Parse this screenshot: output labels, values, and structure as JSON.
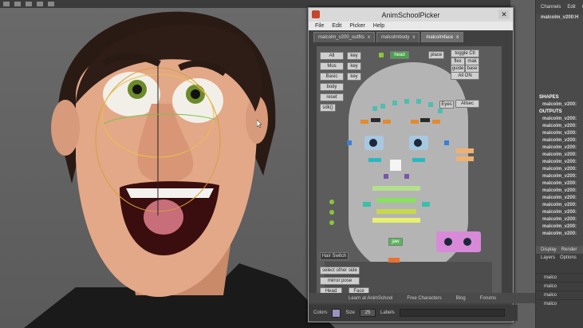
{
  "picker": {
    "title": "AnimSchoolPicker",
    "close": "✕",
    "menu": [
      "File",
      "Edit",
      "Picker",
      "Help"
    ],
    "tabs": [
      {
        "label": "malcolm_v200_outfits",
        "close": "x"
      },
      {
        "label": "malcolmbody",
        "close": "x"
      },
      {
        "label": "malcolmface",
        "close": "x"
      }
    ],
    "buttons": {
      "all": "All",
      "key1": "key",
      "mus": "Mus",
      "key2": "key",
      "basic": "Basic",
      "key3": "key",
      "body": "body",
      "reset": "reset",
      "sdk": "sdk()",
      "head": "head",
      "place": "place",
      "toggle": "toggle Ctl",
      "flex": "flex",
      "mak": "mak",
      "guide": "guide",
      "base": "base",
      "all_on": "All ON",
      "eyes": "Eyes",
      "allsec": "Allsec",
      "jaw": "jaw",
      "hair_switch": "Hair Switch",
      "select_other_side": "select other side",
      "mirror_pose": "mirror pose",
      "head2": "Head",
      "face": "Face"
    },
    "footer": [
      "Learn at AnimSchool",
      "Free Characters",
      "Blog",
      "Forums"
    ],
    "bottom": {
      "colors_label": "Colors",
      "size_label": "Size",
      "size_value": "25",
      "labels_label": "Labels",
      "swatch_color": "#9a93c0"
    }
  },
  "right_panel": {
    "tabs": [
      "Channels",
      "Edit",
      "O"
    ],
    "node": "malcolm_v200:H",
    "shapes_label": "SHAPES",
    "shapes": [
      "malcolm_v200:"
    ],
    "outputs_label": "OUTPUTS",
    "outputs": [
      "malcolm_v200:",
      "malcolm_v200:",
      "malcolm_v200:",
      "malcolm_v200:",
      "malcolm_v200:",
      "malcolm_v200:",
      "malcolm_v200:",
      "malcolm_v200:",
      "malcolm_v200:",
      "malcolm_v200:",
      "malcolm_v200:",
      "malcolm_v200:",
      "malcolm_v200:",
      "malcolm_v200:",
      "malcolm_v200:",
      "malcolm_v200:",
      "malcolm_v200:"
    ],
    "lower_tabs": [
      "Display",
      "Render"
    ],
    "lower_sub": [
      "Layers",
      "Options"
    ],
    "layers": [
      "malco",
      "malco",
      "malco",
      "malco"
    ]
  }
}
